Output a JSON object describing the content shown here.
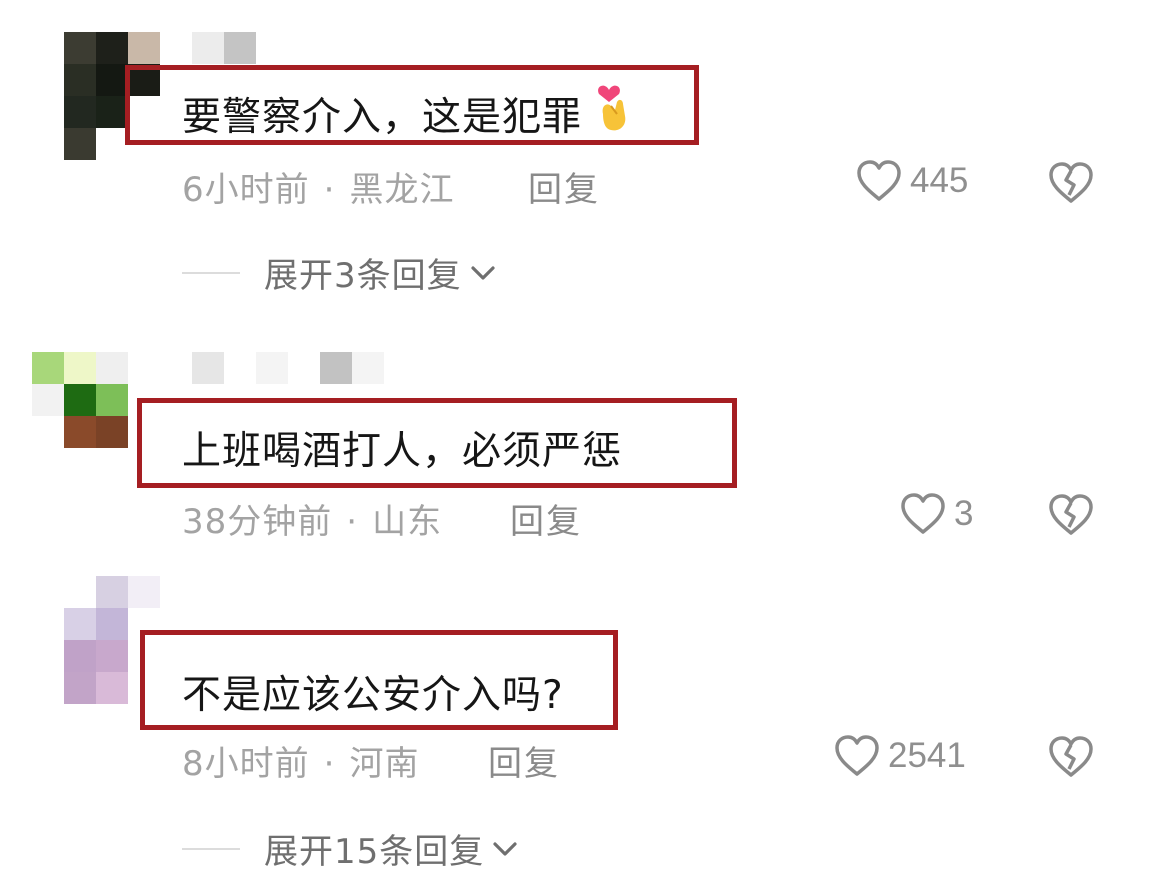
{
  "comments": [
    {
      "text": "要警察介入，这是犯罪",
      "emoji": "finger-heart-icon",
      "time": "6小时前",
      "location": "黑龙江",
      "reply_label": "回复",
      "likes": "445",
      "expand_label": "展开3条回复"
    },
    {
      "text": "上班喝酒打人，必须严惩",
      "time": "38分钟前",
      "location": "山东",
      "reply_label": "回复",
      "likes": "3"
    },
    {
      "text": "不是应该公安介入吗?",
      "time": "8小时前",
      "location": "河南",
      "reply_label": "回复",
      "likes": "2541",
      "expand_label": "展开15条回复"
    }
  ],
  "meta_separator": "·",
  "colors": {
    "highlight_box": "#a51e22",
    "text": "#161616",
    "meta": "#a3a3a3"
  }
}
